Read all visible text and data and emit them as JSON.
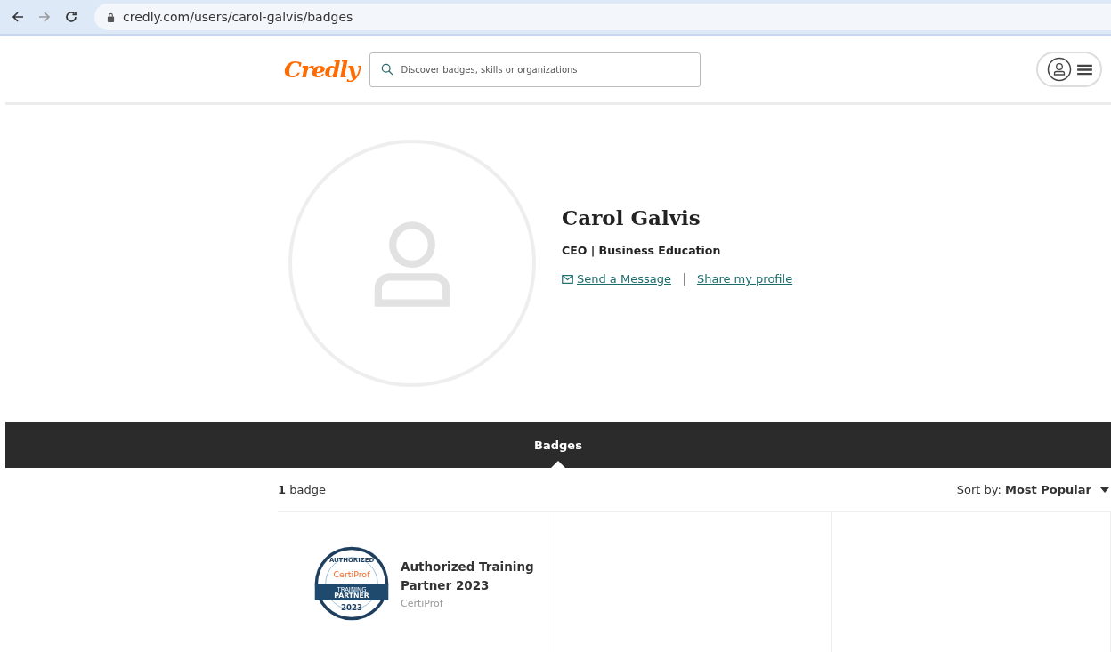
{
  "browser": {
    "url": "credly.com/users/carol-galvis/badges"
  },
  "header": {
    "logo": "Credly",
    "search": {
      "placeholder": "Discover badges, skills or organizations"
    }
  },
  "profile": {
    "name": "Carol Galvis",
    "headline": "CEO | Business Education",
    "links": [
      "Send a Message",
      "Share my profile"
    ]
  },
  "tabs": [
    {
      "label": "Badges",
      "selected": true
    }
  ],
  "badges_bar": {
    "count": "**1** badge",
    "sort": "Sort by: **Most Popular**"
  },
  "badges": [
    {
      "name": "Authorized Training Partner 2023",
      "issuer": "CertiProf",
      "image": {
        "top": "AUTHORIZED",
        "brand": "CertiProf",
        "band_top": "TRAINING",
        "band_bottom": "PARTNER",
        "year": "2023"
      }
    }
  ]
}
